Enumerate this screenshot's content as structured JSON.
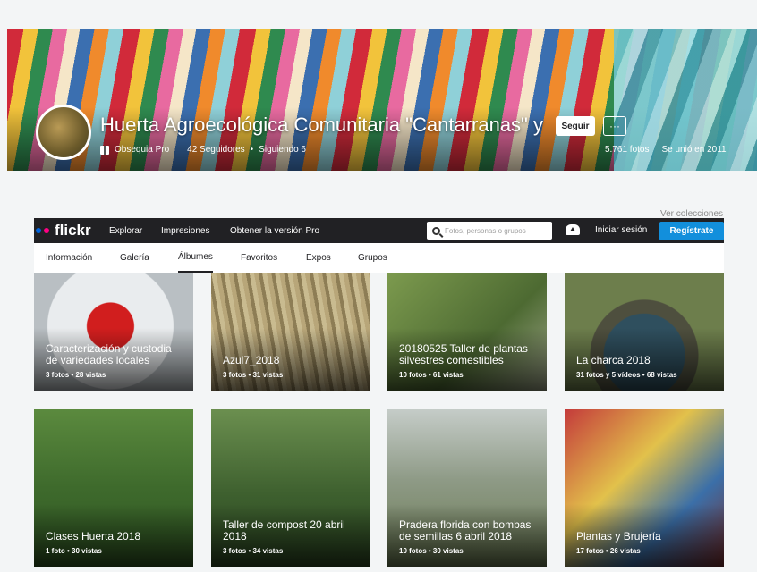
{
  "profile": {
    "name": "Huerta Agroecológica Comunitaria \"Cantarranas\" y",
    "follow_label": "Seguir",
    "more_label": "···",
    "pro_label": "Obsequia Pro",
    "followers": "42 Seguidores",
    "following": "Siguiendo 6",
    "photos_count": "5.761 fotos",
    "joined": "Se unió en 2011"
  },
  "collections_link": "Ver colecciones",
  "topbar": {
    "logo": "flickr",
    "nav": [
      "Explorar",
      "Impresiones",
      "Obtener la versión Pro"
    ],
    "search_placeholder": "Fotos, personas o grupos",
    "signin": "Iniciar sesión",
    "signup": "Regístrate"
  },
  "subnav": {
    "tabs": [
      "Información",
      "Galería",
      "Álbumes",
      "Favoritos",
      "Expos",
      "Grupos"
    ],
    "active": "Álbumes"
  },
  "albums": [
    {
      "title": "Caracterización y custodia de variedades locales",
      "meta": "3 fotos  •  28 vistas",
      "color": "#c9cdcf"
    },
    {
      "title": "Azul7_2018",
      "meta": "3 fotos  •  31 vistas",
      "color": "#9c8f6a"
    },
    {
      "title": "20180525 Taller de plantas silvestres comestibles",
      "meta": "10 fotos  •  61 vistas",
      "color": "#6f8a4a"
    },
    {
      "title": "La charca 2018",
      "meta": "31 fotos y 5 vídeos  •  68 vistas",
      "color": "#5d6d48"
    },
    {
      "title": "Clases Huerta 2018",
      "meta": "1 foto  •  30 vistas",
      "color": "#4f7a3a"
    },
    {
      "title": "Taller de compost 20 abril 2018",
      "meta": "3 fotos  •  34 vistas",
      "color": "#3f6b34"
    },
    {
      "title": "Pradera florida con bombas de semillas 6 abril 2018",
      "meta": "10 fotos  •  30 vistas",
      "color": "#8f9a88"
    },
    {
      "title": "Plantas y Brujería",
      "meta": "17 fotos  •  26 vistas",
      "color": "#a23a3a"
    }
  ]
}
